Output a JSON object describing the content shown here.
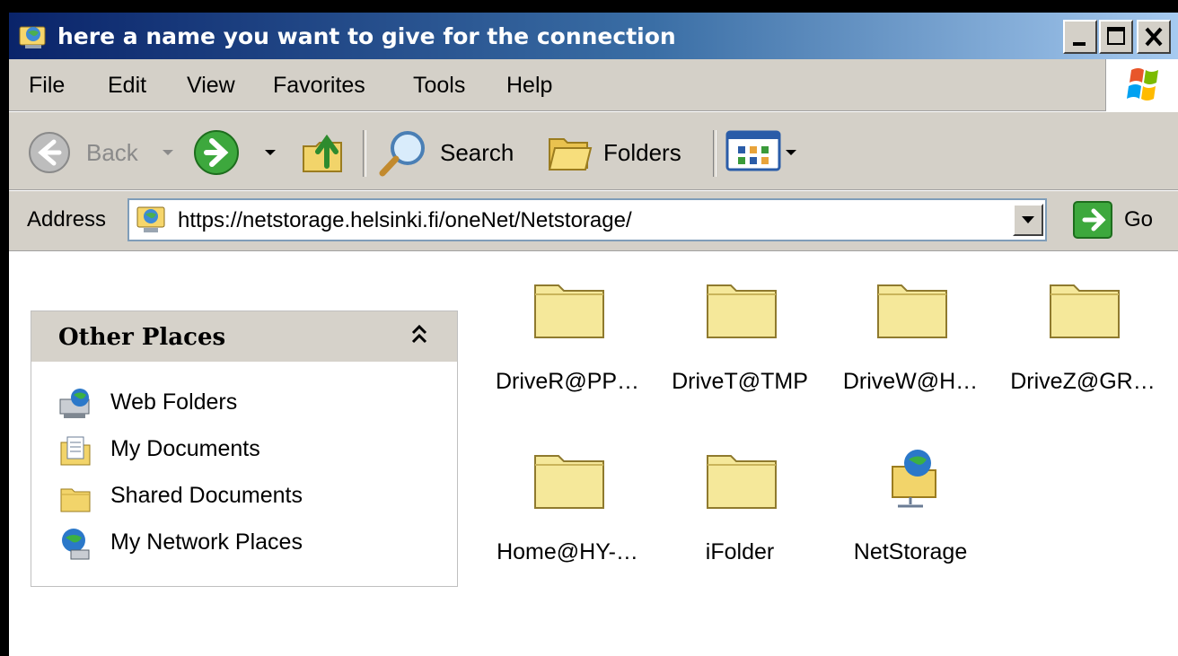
{
  "window": {
    "title": "here a name you want to give for the connection"
  },
  "menu": [
    "File",
    "Edit",
    "View",
    "Favorites",
    "Tools",
    "Help"
  ],
  "toolbar": {
    "back_label": "Back",
    "search_label": "Search",
    "folders_label": "Folders"
  },
  "address": {
    "label": "Address",
    "url": "https://netstorage.helsinki.fi/oneNet/Netstorage/",
    "go_label": "Go"
  },
  "other_places": {
    "title": "Other Places",
    "items": [
      {
        "label": "Web Folders",
        "icon": "web-folders-icon"
      },
      {
        "label": "My Documents",
        "icon": "my-documents-icon"
      },
      {
        "label": "Shared Documents",
        "icon": "folder-icon"
      },
      {
        "label": "My Network Places",
        "icon": "network-places-icon"
      }
    ]
  },
  "files": [
    {
      "label": "DriveR@PP…",
      "icon": "folder-icon"
    },
    {
      "label": "DriveT@TMP",
      "icon": "folder-icon"
    },
    {
      "label": "DriveW@H…",
      "icon": "folder-icon"
    },
    {
      "label": "DriveZ@GR…",
      "icon": "folder-icon"
    },
    {
      "label": "Home@HY-…",
      "icon": "folder-icon"
    },
    {
      "label": "iFolder",
      "icon": "folder-icon"
    },
    {
      "label": "NetStorage",
      "icon": "network-folder-icon"
    }
  ],
  "colors": {
    "titlebar_start": "#0a246a",
    "titlebar_end": "#a6caf0",
    "chrome": "#d4d0c8",
    "folder": "#f5e89a"
  }
}
